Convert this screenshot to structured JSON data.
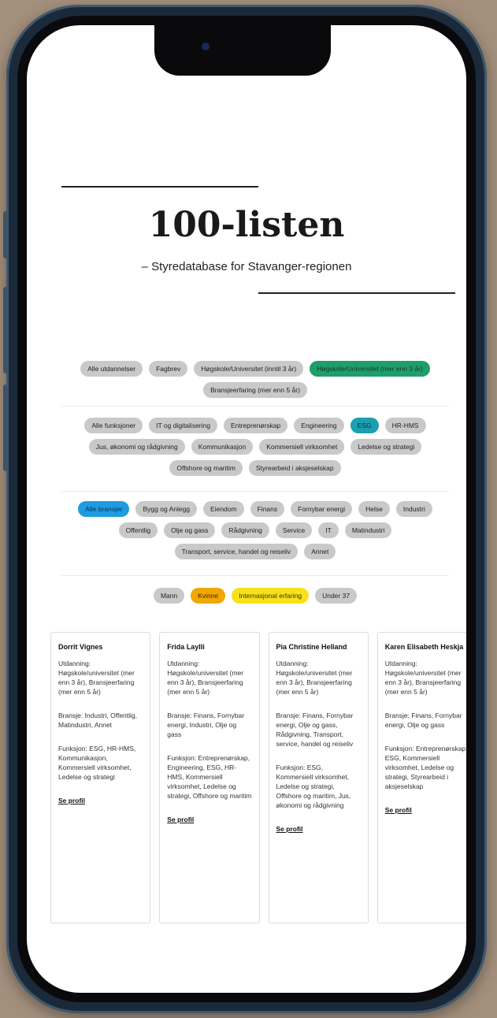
{
  "page": {
    "title": "100-listen",
    "subtitle": "– Styredatabase for Stavanger-regionen"
  },
  "filters": {
    "education": [
      {
        "label": "Alle utdannelser",
        "active": false
      },
      {
        "label": "Fagbrev",
        "active": false
      },
      {
        "label": "Høgskole/Universitet (inntil 3 år)",
        "active": false
      },
      {
        "label": "Høgskole/Universitet (mer enn 3 år)",
        "active": true,
        "color": "#1f9e6b"
      },
      {
        "label": "Bransjeerfaring (mer enn 5 år)",
        "active": false
      }
    ],
    "functions": [
      {
        "label": "Alle funksjoner",
        "active": false
      },
      {
        "label": "IT og digitalisering",
        "active": false
      },
      {
        "label": "Entreprenørskap",
        "active": false
      },
      {
        "label": "Engineering",
        "active": false
      },
      {
        "label": "ESG",
        "active": true,
        "color": "#1c9fb0"
      },
      {
        "label": "HR-HMS",
        "active": false
      },
      {
        "label": "Jus, økonomi og rådgivning",
        "active": false
      },
      {
        "label": "Kommunikasjon",
        "active": false
      },
      {
        "label": "Kommersiell virksomhet",
        "active": false
      },
      {
        "label": "Ledelse og strategi",
        "active": false
      },
      {
        "label": "Offshore og maritim",
        "active": false
      },
      {
        "label": "Styrearbeid i aksjeselskap",
        "active": false
      }
    ],
    "industries": [
      {
        "label": "Alle bransjer",
        "active": true,
        "color": "#1f9be0"
      },
      {
        "label": "Bygg og Anlegg",
        "active": false
      },
      {
        "label": "Eiendom",
        "active": false
      },
      {
        "label": "Finans",
        "active": false
      },
      {
        "label": "Fornybar energi",
        "active": false
      },
      {
        "label": "Helse",
        "active": false
      },
      {
        "label": "Industri",
        "active": false
      },
      {
        "label": "Offentlig",
        "active": false
      },
      {
        "label": "Olje og gass",
        "active": false
      },
      {
        "label": "Rådgivning",
        "active": false
      },
      {
        "label": "Service",
        "active": false
      },
      {
        "label": "IT",
        "active": false
      },
      {
        "label": "Matindustri",
        "active": false
      },
      {
        "label": "Transport, service, handel og reiseliv",
        "active": false
      },
      {
        "label": "Annet",
        "active": false
      }
    ],
    "other": [
      {
        "label": "Mann",
        "active": false
      },
      {
        "label": "Kvinne",
        "active": true,
        "color": "#f0a800"
      },
      {
        "label": "Internasjonal erfaring",
        "active": true,
        "color": "#f7e11a"
      },
      {
        "label": "Under 37",
        "active": false
      }
    ]
  },
  "profiles": [
    {
      "name": "Dorrit Vignes",
      "education": "Utdanning: Høgskole/universitet (mer enn 3 år), Bransjeerfaring (mer enn 5 år)",
      "industry": "Bransje: Industri, Offentlig, Matindustri, Annet",
      "function": "Funksjon: ESG, HR-HMS, Kommunikasjon, Kommersiell virksomhet, Ledelse og strategi",
      "link": "Se profil"
    },
    {
      "name": "Frida Laylli",
      "education": "Utdanning: Høgskole/universitet (mer enn 3 år), Bransjeerfaring (mer enn 5 år)",
      "industry": "Bransje: Finans, Fornybar energi, Industri, Olje og gass",
      "function": "Funksjon: Entreprenørskap, Engineering, ESG, HR-HMS, Kommersiell virksomhet, Ledelse og strategi, Offshore og maritim",
      "link": "Se profil"
    },
    {
      "name": "Pia Christine Helland",
      "education": "Utdanning: Høgskole/universitet (mer enn 3 år), Bransjeerfaring (mer enn 5 år)",
      "industry": "Bransje: Finans, Fornybar energi, Olje og gass, Rådgivning, Transport, service, handel og reiseliv",
      "function": "Funksjon: ESG, Kommersiell virksomhet, Ledelse og strategi, Offshore og maritim, Jus, økonomi og rådgivning",
      "link": "Se profil"
    },
    {
      "name": "Karen Elisabeth Heskja",
      "education": "Utdanning: Høgskole/universitet (mer enn 3 år), Bransjeerfaring (mer enn 5 år)",
      "industry": "Bransje: Finans, Fornybar energi, Olje og gass",
      "function": "Funksjon: Entreprenørskap, ESG, Kommersiell virksomhet, Ledelse og strategi, Styrearbeid i aksjeselskap",
      "link": "Se profil"
    }
  ]
}
